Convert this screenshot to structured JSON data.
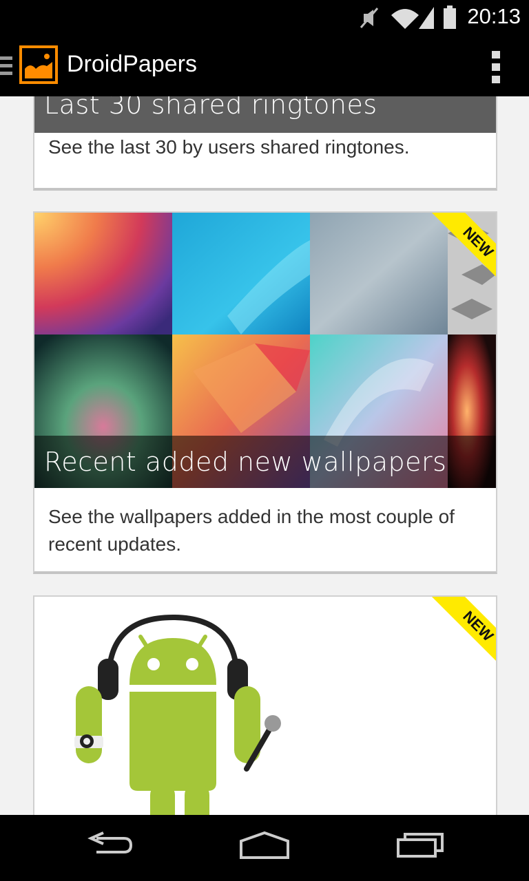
{
  "status_bar": {
    "time": "20:13",
    "icons": [
      "mute-icon",
      "wifi-icon",
      "signal-icon",
      "battery-icon"
    ]
  },
  "action_bar": {
    "title": "DroidPapers",
    "icons": [
      "drawer-icon",
      "app-logo-icon",
      "overflow-menu-icon"
    ],
    "accent_color": "#ff8c00"
  },
  "cards": [
    {
      "caption": "Last 30 shared ringtones",
      "description": "See the last 30 by users shared ringtones."
    },
    {
      "caption": "Recent added new wallpapers",
      "description": "See the wallpapers added in the most couple of recent updates.",
      "badge": "NEW"
    },
    {
      "caption": "",
      "description": "",
      "badge": "NEW",
      "image": "android-robot-headphones-icon"
    }
  ],
  "nav_bar": {
    "icons": [
      "back-icon",
      "home-icon",
      "recent-apps-icon"
    ]
  }
}
